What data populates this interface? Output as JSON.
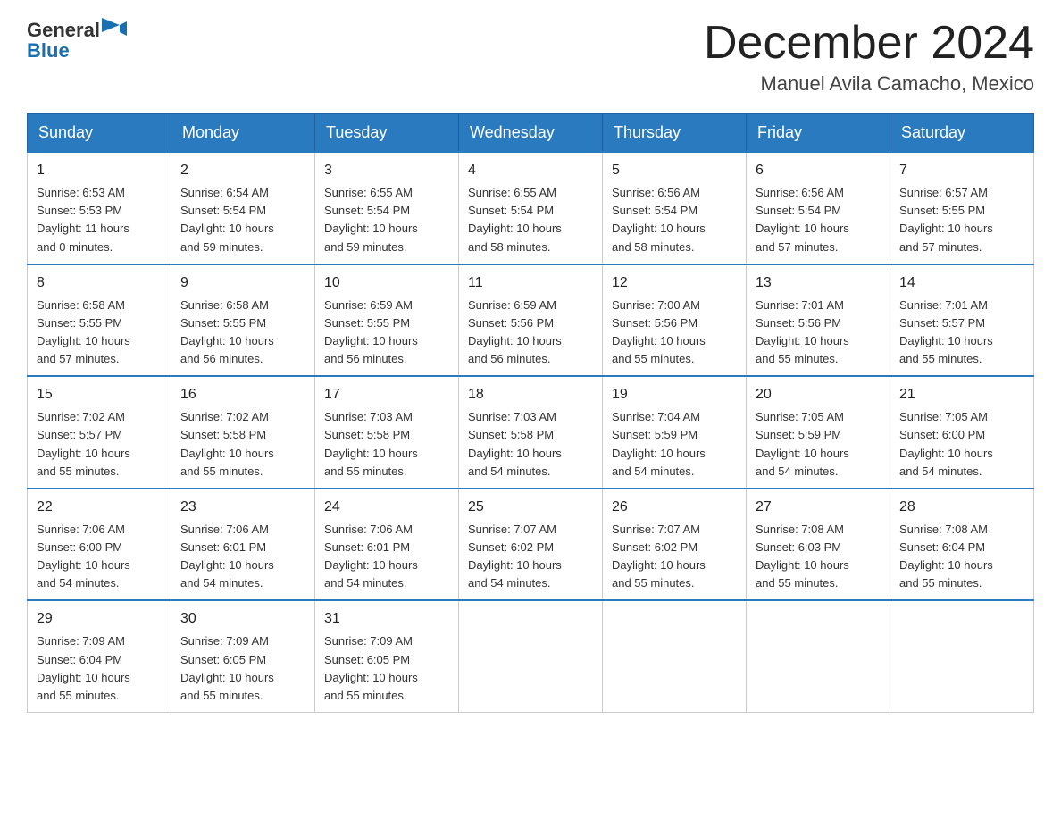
{
  "header": {
    "logo_general": "General",
    "logo_blue": "Blue",
    "month_title": "December 2024",
    "location": "Manuel Avila Camacho, Mexico"
  },
  "days_of_week": [
    "Sunday",
    "Monday",
    "Tuesday",
    "Wednesday",
    "Thursday",
    "Friday",
    "Saturday"
  ],
  "weeks": [
    [
      {
        "day": "1",
        "sunrise": "6:53 AM",
        "sunset": "5:53 PM",
        "daylight": "11 hours and 0 minutes."
      },
      {
        "day": "2",
        "sunrise": "6:54 AM",
        "sunset": "5:54 PM",
        "daylight": "10 hours and 59 minutes."
      },
      {
        "day": "3",
        "sunrise": "6:55 AM",
        "sunset": "5:54 PM",
        "daylight": "10 hours and 59 minutes."
      },
      {
        "day": "4",
        "sunrise": "6:55 AM",
        "sunset": "5:54 PM",
        "daylight": "10 hours and 58 minutes."
      },
      {
        "day": "5",
        "sunrise": "6:56 AM",
        "sunset": "5:54 PM",
        "daylight": "10 hours and 58 minutes."
      },
      {
        "day": "6",
        "sunrise": "6:56 AM",
        "sunset": "5:54 PM",
        "daylight": "10 hours and 57 minutes."
      },
      {
        "day": "7",
        "sunrise": "6:57 AM",
        "sunset": "5:55 PM",
        "daylight": "10 hours and 57 minutes."
      }
    ],
    [
      {
        "day": "8",
        "sunrise": "6:58 AM",
        "sunset": "5:55 PM",
        "daylight": "10 hours and 57 minutes."
      },
      {
        "day": "9",
        "sunrise": "6:58 AM",
        "sunset": "5:55 PM",
        "daylight": "10 hours and 56 minutes."
      },
      {
        "day": "10",
        "sunrise": "6:59 AM",
        "sunset": "5:55 PM",
        "daylight": "10 hours and 56 minutes."
      },
      {
        "day": "11",
        "sunrise": "6:59 AM",
        "sunset": "5:56 PM",
        "daylight": "10 hours and 56 minutes."
      },
      {
        "day": "12",
        "sunrise": "7:00 AM",
        "sunset": "5:56 PM",
        "daylight": "10 hours and 55 minutes."
      },
      {
        "day": "13",
        "sunrise": "7:01 AM",
        "sunset": "5:56 PM",
        "daylight": "10 hours and 55 minutes."
      },
      {
        "day": "14",
        "sunrise": "7:01 AM",
        "sunset": "5:57 PM",
        "daylight": "10 hours and 55 minutes."
      }
    ],
    [
      {
        "day": "15",
        "sunrise": "7:02 AM",
        "sunset": "5:57 PM",
        "daylight": "10 hours and 55 minutes."
      },
      {
        "day": "16",
        "sunrise": "7:02 AM",
        "sunset": "5:58 PM",
        "daylight": "10 hours and 55 minutes."
      },
      {
        "day": "17",
        "sunrise": "7:03 AM",
        "sunset": "5:58 PM",
        "daylight": "10 hours and 55 minutes."
      },
      {
        "day": "18",
        "sunrise": "7:03 AM",
        "sunset": "5:58 PM",
        "daylight": "10 hours and 54 minutes."
      },
      {
        "day": "19",
        "sunrise": "7:04 AM",
        "sunset": "5:59 PM",
        "daylight": "10 hours and 54 minutes."
      },
      {
        "day": "20",
        "sunrise": "7:05 AM",
        "sunset": "5:59 PM",
        "daylight": "10 hours and 54 minutes."
      },
      {
        "day": "21",
        "sunrise": "7:05 AM",
        "sunset": "6:00 PM",
        "daylight": "10 hours and 54 minutes."
      }
    ],
    [
      {
        "day": "22",
        "sunrise": "7:06 AM",
        "sunset": "6:00 PM",
        "daylight": "10 hours and 54 minutes."
      },
      {
        "day": "23",
        "sunrise": "7:06 AM",
        "sunset": "6:01 PM",
        "daylight": "10 hours and 54 minutes."
      },
      {
        "day": "24",
        "sunrise": "7:06 AM",
        "sunset": "6:01 PM",
        "daylight": "10 hours and 54 minutes."
      },
      {
        "day": "25",
        "sunrise": "7:07 AM",
        "sunset": "6:02 PM",
        "daylight": "10 hours and 54 minutes."
      },
      {
        "day": "26",
        "sunrise": "7:07 AM",
        "sunset": "6:02 PM",
        "daylight": "10 hours and 55 minutes."
      },
      {
        "day": "27",
        "sunrise": "7:08 AM",
        "sunset": "6:03 PM",
        "daylight": "10 hours and 55 minutes."
      },
      {
        "day": "28",
        "sunrise": "7:08 AM",
        "sunset": "6:04 PM",
        "daylight": "10 hours and 55 minutes."
      }
    ],
    [
      {
        "day": "29",
        "sunrise": "7:09 AM",
        "sunset": "6:04 PM",
        "daylight": "10 hours and 55 minutes."
      },
      {
        "day": "30",
        "sunrise": "7:09 AM",
        "sunset": "6:05 PM",
        "daylight": "10 hours and 55 minutes."
      },
      {
        "day": "31",
        "sunrise": "7:09 AM",
        "sunset": "6:05 PM",
        "daylight": "10 hours and 55 minutes."
      },
      null,
      null,
      null,
      null
    ]
  ]
}
